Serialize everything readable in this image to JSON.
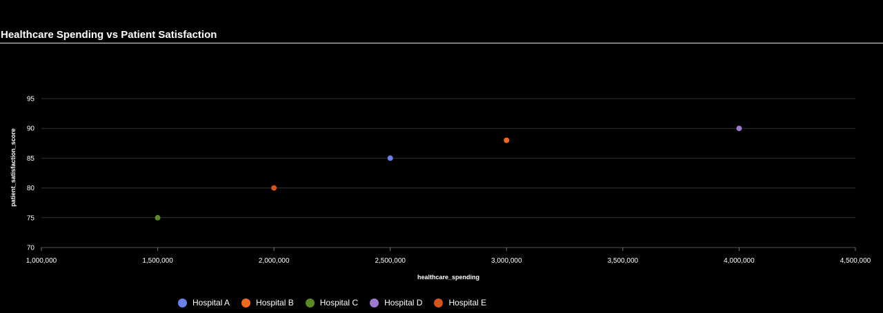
{
  "page": {
    "title": "Healthcare Spending vs Patient Satisfaction"
  },
  "chart_data": {
    "type": "scatter",
    "title": "Healthcare Spending vs Patient Satisfaction",
    "xlabel": "healthcare_spending",
    "ylabel": "patient_satisfaction_score",
    "xlim": [
      1000000,
      4500000
    ],
    "ylim": [
      70,
      95
    ],
    "x_ticks": [
      1000000,
      1500000,
      2000000,
      2500000,
      3000000,
      3500000,
      4000000,
      4500000
    ],
    "x_tick_labels": [
      "1,000,000",
      "1,500,000",
      "2,000,000",
      "2,500,000",
      "3,000,000",
      "3,500,000",
      "4,000,000",
      "4,500,000"
    ],
    "y_ticks": [
      70,
      75,
      80,
      85,
      90,
      95
    ],
    "y_tick_labels": [
      "70",
      "75",
      "80",
      "85",
      "90",
      "95"
    ],
    "grid": true,
    "legend_position": "bottom-left",
    "series": [
      {
        "name": "Hospital A",
        "color": "#6a7fe8",
        "points": [
          {
            "x": 2500000,
            "y": 85
          }
        ]
      },
      {
        "name": "Hospital B",
        "color": "#f26a1b",
        "points": [
          {
            "x": 3000000,
            "y": 88
          }
        ]
      },
      {
        "name": "Hospital C",
        "color": "#5a8a22",
        "points": [
          {
            "x": 1500000,
            "y": 75
          }
        ]
      },
      {
        "name": "Hospital D",
        "color": "#9b7ad0",
        "points": [
          {
            "x": 4000000,
            "y": 90
          }
        ]
      },
      {
        "name": "Hospital E",
        "color": "#d4541c",
        "points": [
          {
            "x": 2000000,
            "y": 80
          }
        ]
      }
    ]
  }
}
